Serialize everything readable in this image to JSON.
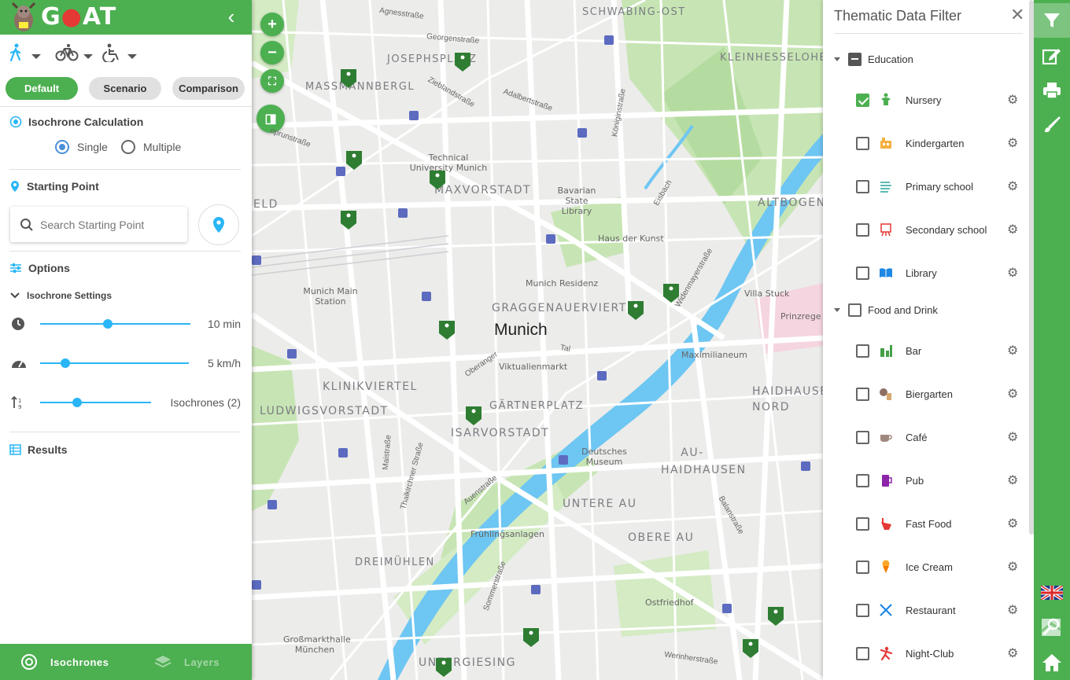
{
  "app": {
    "name": "GOAT"
  },
  "modes": [
    "walking",
    "cycling",
    "wheelchair"
  ],
  "mode_buttons": [
    {
      "label": "Default",
      "active": true
    },
    {
      "label": "Scenario",
      "active": false
    },
    {
      "label": "Comparison",
      "active": false
    }
  ],
  "isochrone": {
    "title": "Isochrone Calculation",
    "single": "Single",
    "multiple": "Multiple",
    "selected": "Single"
  },
  "starting_point": {
    "title": "Starting Point",
    "placeholder": "Search Starting Point"
  },
  "options": {
    "title": "Options",
    "settings_title": "Isochrone Settings",
    "time": {
      "value": "10 min",
      "fraction": 0.45
    },
    "speed": {
      "value": "5 km/h",
      "fraction": 0.17
    },
    "count": {
      "value": "Isochrones (2)",
      "fraction": 0.33
    }
  },
  "results": {
    "title": "Results"
  },
  "footer": {
    "isochrones": "Isochrones",
    "layers": "Layers"
  },
  "map": {
    "districts": [
      "SCHWABING-OST",
      "JOSEPHSPLATZ",
      "MASSMANNBERGL",
      "MAXVORSTADT",
      "KLEINHESSELOHE",
      "ALTBOGEN",
      "GRAGGENAUERVIERTEL",
      "KLINIKVIERTEL",
      "LUDWIGSVORSTADT",
      "GÄRTNERPLATZ",
      "ISARVORSTADT",
      "AU-HAIDHAUSEN",
      "HAIDHAUSEN-NORD",
      "UNTERE AU",
      "OBERE AU",
      "DREIMÜHLEN",
      "UNTERGIESING",
      "ELD"
    ],
    "city": "Munich",
    "places": [
      "Technical University Munich",
      "Bavarian State Library",
      "Haus der Kunst",
      "Munich Residenz",
      "Munich Main Station",
      "Villa Stuck",
      "Maximilianeum",
      "Viktualienmarkt",
      "Deutsches Museum",
      "Frühlingsanlagen",
      "Ostfriedhof",
      "Großmarkthalle München",
      "Prinzrege"
    ],
    "streets": [
      "Agnesstraße",
      "Georgenstraße",
      "Zieblandstraße",
      "Adalbertstraße",
      "Königinstraße",
      "Eisbach",
      "Widenmayerstraße",
      "Tal",
      "Oberanger",
      "Maistraße",
      "Thalkirchner Straße",
      "Auenstraße",
      "Sommerstraße",
      "Balanstraße",
      "Werinherstraße",
      "nprunstraße"
    ]
  },
  "filter": {
    "title": "Thematic Data Filter",
    "groups": [
      {
        "name": "Education",
        "state": "indeterminate",
        "items": [
          {
            "name": "Nursery",
            "checked": true,
            "icon": "nursery-icon",
            "color": "#4caf50"
          },
          {
            "name": "Kindergarten",
            "checked": false,
            "icon": "kindergarten-icon",
            "color": "#f5b041"
          },
          {
            "name": "Primary school",
            "checked": false,
            "icon": "primary-school-icon",
            "color": "#26a69a"
          },
          {
            "name": "Secondary school",
            "checked": false,
            "icon": "secondary-school-icon",
            "color": "#e53935"
          },
          {
            "name": "Library",
            "checked": false,
            "icon": "library-icon",
            "color": "#1e88e5"
          }
        ]
      },
      {
        "name": "Food and Drink",
        "state": "unchecked",
        "items": [
          {
            "name": "Bar",
            "checked": false,
            "icon": "bar-icon",
            "color": "#43a047"
          },
          {
            "name": "Biergarten",
            "checked": false,
            "icon": "biergarten-icon",
            "color": "#8d6e63"
          },
          {
            "name": "Café",
            "checked": false,
            "icon": "cafe-icon",
            "color": "#a1887f"
          },
          {
            "name": "Pub",
            "checked": false,
            "icon": "pub-icon",
            "color": "#8e24aa"
          },
          {
            "name": "Fast Food",
            "checked": false,
            "icon": "fast-food-icon",
            "color": "#e53935"
          },
          {
            "name": "Ice Cream",
            "checked": false,
            "icon": "ice-cream-icon",
            "color": "#ffa726"
          },
          {
            "name": "Restaurant",
            "checked": false,
            "icon": "restaurant-icon",
            "color": "#1e88e5"
          },
          {
            "name": "Night-Club",
            "checked": false,
            "icon": "night-club-icon",
            "color": "#e53935"
          }
        ]
      }
    ]
  },
  "colors": {
    "primary": "#4caf50",
    "accent": "#29b6f6",
    "water": "#4fc3f7"
  }
}
